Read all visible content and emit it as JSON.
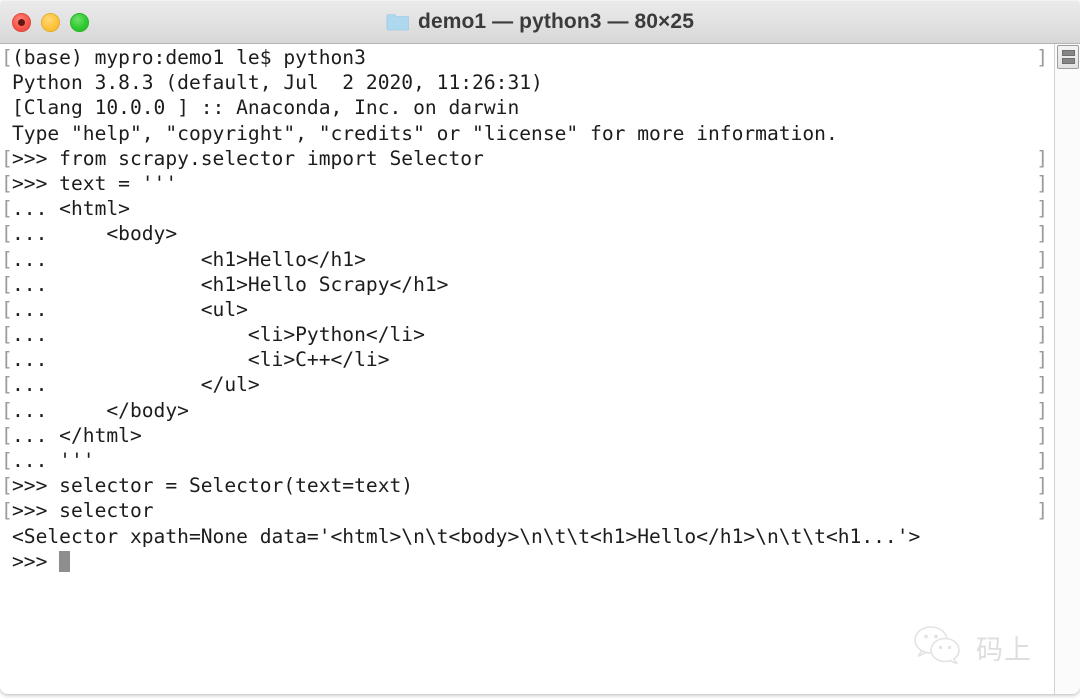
{
  "window": {
    "title": "demo1 — python3 — 80×25",
    "folder_icon": "folder-icon",
    "traffic_lights": [
      {
        "name": "close-button",
        "label": "Close",
        "color": "#f9564b"
      },
      {
        "name": "minimize-button",
        "label": "Minimize",
        "color": "#fdc23c"
      },
      {
        "name": "maximize-button",
        "label": "Maximize",
        "color": "#2ec92e"
      }
    ]
  },
  "terminal": {
    "prompt_marker_open": "[",
    "prompt_marker_close": "]",
    "cursor": "block-cursor",
    "lines": [
      {
        "text": "(base) mypro:demo1 le$ python3",
        "marked": true
      },
      {
        "text": "Python 3.8.3 (default, Jul  2 2020, 11:26:31)",
        "marked": false
      },
      {
        "text": "[Clang 10.0.0 ] :: Anaconda, Inc. on darwin",
        "marked": false
      },
      {
        "text": "Type \"help\", \"copyright\", \"credits\" or \"license\" for more information.",
        "marked": false
      },
      {
        "text": ">>> from scrapy.selector import Selector",
        "marked": true
      },
      {
        "text": ">>> text = '''",
        "marked": true
      },
      {
        "text": "... <html>",
        "marked": true
      },
      {
        "text": "...     <body>",
        "marked": true
      },
      {
        "text": "...             <h1>Hello</h1>",
        "marked": true
      },
      {
        "text": "...             <h1>Hello Scrapy</h1>",
        "marked": true
      },
      {
        "text": "...             <ul>",
        "marked": true
      },
      {
        "text": "...                 <li>Python</li>",
        "marked": true
      },
      {
        "text": "...                 <li>C++</li>",
        "marked": true
      },
      {
        "text": "...             </ul>",
        "marked": true
      },
      {
        "text": "...     </body>",
        "marked": true
      },
      {
        "text": "... </html>",
        "marked": true
      },
      {
        "text": "... '''",
        "marked": true
      },
      {
        "text": ">>> selector = Selector(text=text)",
        "marked": true
      },
      {
        "text": ">>> selector",
        "marked": true
      },
      {
        "text": "<Selector xpath=None data='<html>\\n\\t<body>\\n\\t\\t<h1>Hello</h1>\\n\\t\\t<h1...'>",
        "marked": false
      },
      {
        "text": ">>> ",
        "marked": false,
        "cursor": true
      }
    ]
  },
  "scrollbar": {
    "thumb_label": "scroll-thumb"
  },
  "watermark": {
    "logo": "wechat-logo-icon",
    "text": "码上"
  }
}
